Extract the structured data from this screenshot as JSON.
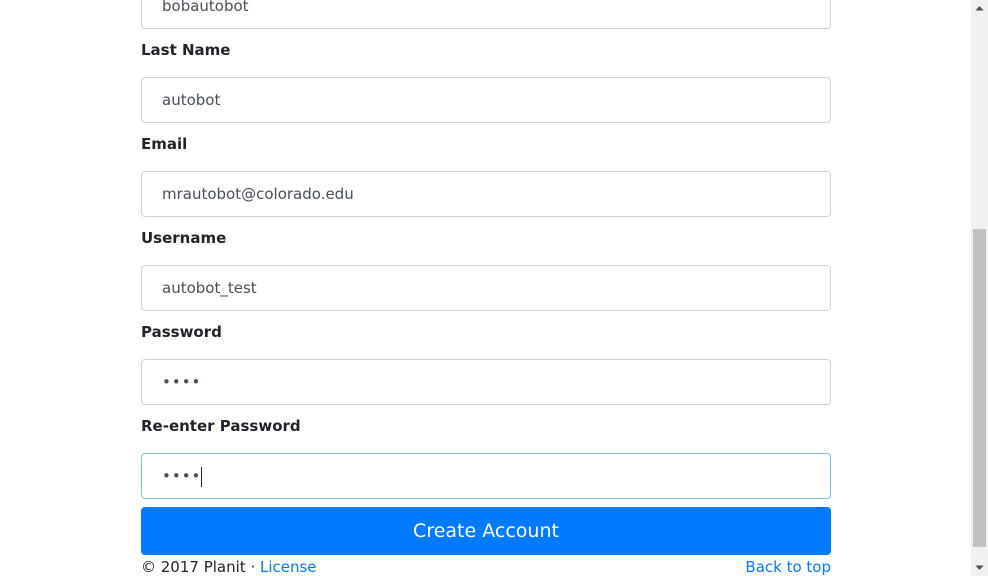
{
  "form": {
    "first_name_value": "bobautobot",
    "last_name_label": "Last Name",
    "last_name_value": "autobot",
    "email_label": "Email",
    "email_value": "mrautobot@colorado.edu",
    "username_label": "Username",
    "username_value": "autobot_test",
    "password_label": "Password",
    "password_value": "••••",
    "reenter_password_label": "Re-enter Password",
    "reenter_password_value": "••••",
    "submit_label": "Create Account"
  },
  "footer": {
    "copyright": "© 2017 Planit · ",
    "license_link": "License",
    "back_to_top_link": "Back to top"
  },
  "colors": {
    "primary": "#007bff",
    "input_border": "#ced4da",
    "focus_border": "#80bdff",
    "text": "#212529"
  },
  "icons": {
    "scroll_up": "triangle-up-icon",
    "scroll_down": "triangle-down-icon"
  }
}
